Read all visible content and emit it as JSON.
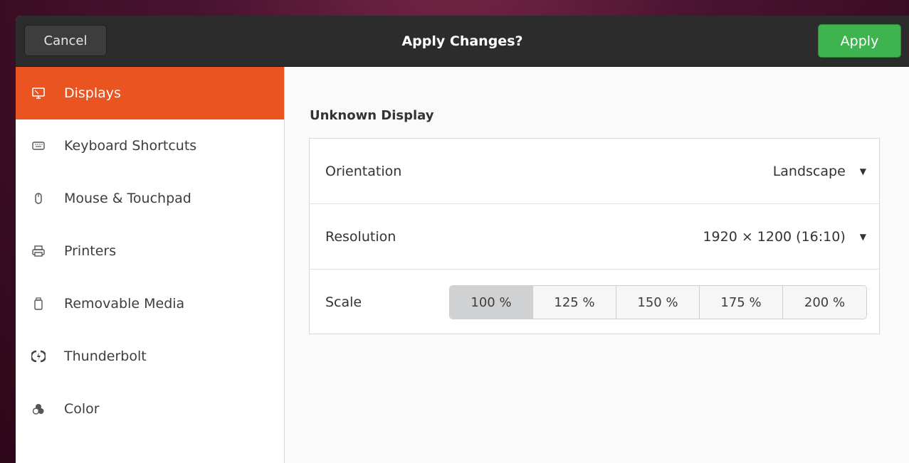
{
  "header": {
    "cancel_label": "Cancel",
    "title": "Apply Changes?",
    "apply_label": "Apply"
  },
  "sidebar": {
    "items": [
      {
        "label": "Displays",
        "icon": "display-icon",
        "active": true
      },
      {
        "label": "Keyboard Shortcuts",
        "icon": "keyboard-icon",
        "active": false
      },
      {
        "label": "Mouse & Touchpad",
        "icon": "mouse-icon",
        "active": false
      },
      {
        "label": "Printers",
        "icon": "printer-icon",
        "active": false
      },
      {
        "label": "Removable Media",
        "icon": "removable-media-icon",
        "active": false
      },
      {
        "label": "Thunderbolt",
        "icon": "thunderbolt-icon",
        "active": false
      },
      {
        "label": "Color",
        "icon": "color-icon",
        "active": false
      }
    ]
  },
  "content": {
    "section_title": "Unknown Display",
    "orientation": {
      "label": "Orientation",
      "value": "Landscape"
    },
    "resolution": {
      "label": "Resolution",
      "value": "1920 × 1200 (16:10)"
    },
    "scale": {
      "label": "Scale",
      "options": [
        "100 %",
        "125 %",
        "150 %",
        "175 %",
        "200 %"
      ],
      "selected": "100 %"
    }
  },
  "colors": {
    "accent": "#e95420",
    "apply_button": "#3eb34f",
    "headerbar": "#2c2c2c"
  }
}
